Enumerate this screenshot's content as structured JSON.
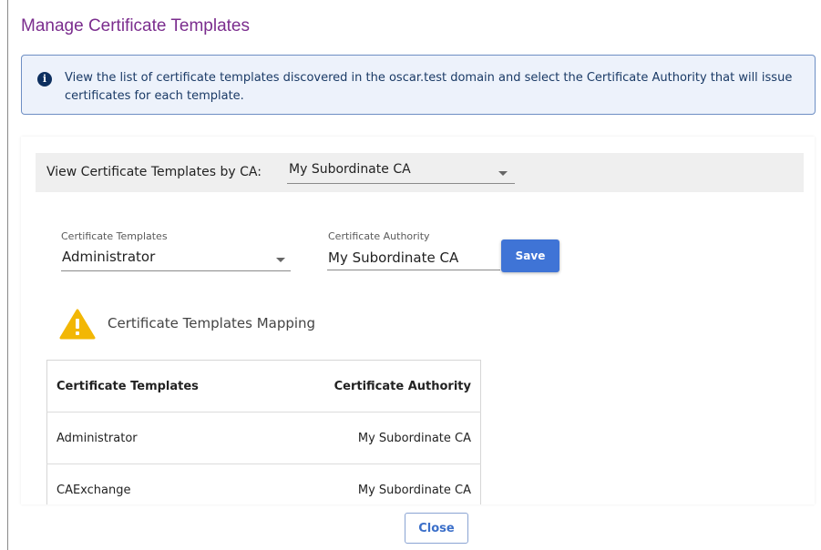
{
  "dialog": {
    "title": "Manage Certificate Templates",
    "info_text": "View the list of certificate templates discovered in the oscar.test domain and select the Certificate Authority that will issue certificates for each template."
  },
  "ca_filter": {
    "label": "View Certificate Templates by CA:",
    "selected": "My Subordinate CA"
  },
  "form": {
    "template_label": "Certificate Templates",
    "template_value": "Administrator",
    "authority_label": "Certificate Authority",
    "authority_value": "My Subordinate CA",
    "save_label": "Save"
  },
  "mapping": {
    "title": "Certificate Templates Mapping",
    "columns": [
      "Certificate Templates",
      "Certificate Authority"
    ],
    "rows": [
      [
        "Administrator",
        "My Subordinate CA"
      ],
      [
        "CAExchange",
        "My Subordinate CA"
      ]
    ]
  },
  "footer": {
    "close_label": "Close"
  },
  "colors": {
    "title": "#7b2d8e",
    "primary": "#3f74d6",
    "warning": "#f2b705",
    "info_bg": "#edf2fb"
  },
  "icons": {
    "info": "info-icon",
    "warning": "warning-icon",
    "dropdown": "chevron-down-icon"
  }
}
